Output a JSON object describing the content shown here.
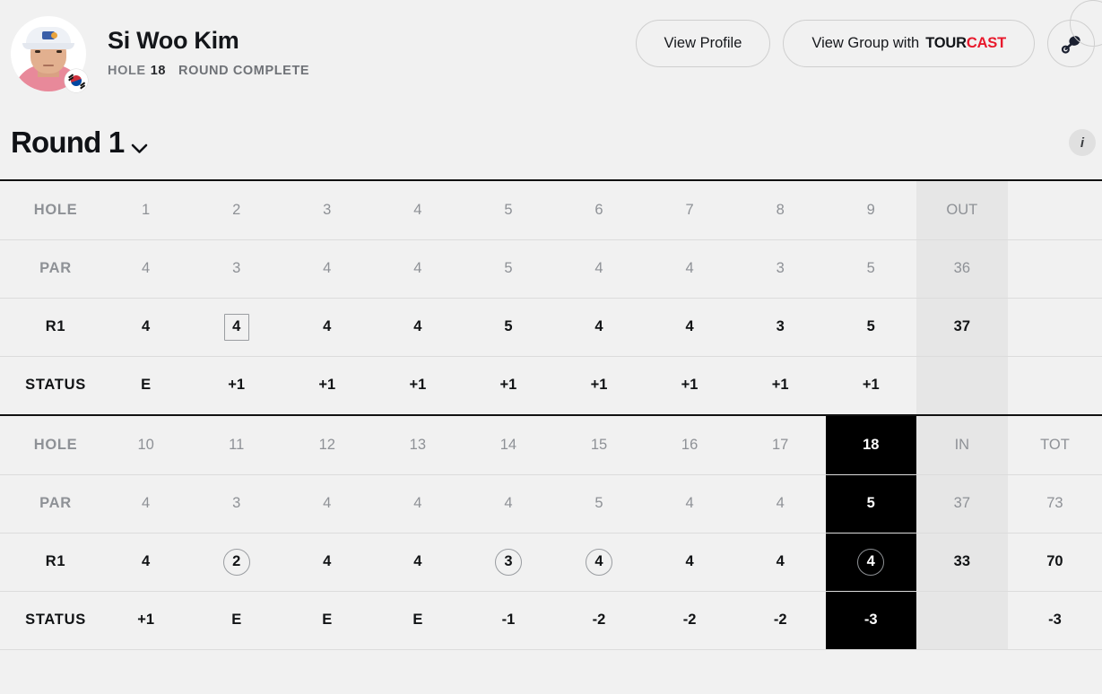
{
  "header": {
    "player_name": "Si Woo Kim",
    "hole_label": "HOLE",
    "hole_number": "18",
    "round_state": "ROUND COMPLETE",
    "view_profile_label": "View Profile",
    "view_group_label": "View Group with",
    "tourcast_tour": "TOUR",
    "tourcast_cast": "CAST",
    "flag_country": "South Korea"
  },
  "round_selector": {
    "label": "Round 1",
    "chevron": "chevron-down-icon",
    "info_label": "i"
  },
  "row_labels": {
    "hole": "HOLE",
    "par": "PAR",
    "score": "R1",
    "status": "STATUS"
  },
  "front_nine": {
    "agg_header": "OUT",
    "holes": [
      "1",
      "2",
      "3",
      "4",
      "5",
      "6",
      "7",
      "8",
      "9"
    ],
    "pars": [
      "4",
      "3",
      "4",
      "4",
      "5",
      "4",
      "4",
      "3",
      "5"
    ],
    "scores": [
      "4",
      "4",
      "4",
      "4",
      "5",
      "4",
      "4",
      "3",
      "5"
    ],
    "score_marks": [
      "",
      "square",
      "",
      "",
      "",
      "",
      "",
      "",
      ""
    ],
    "statuses": [
      "E",
      "+1",
      "+1",
      "+1",
      "+1",
      "+1",
      "+1",
      "+1",
      "+1"
    ],
    "par_total": "36",
    "score_total": "37",
    "status_total": "",
    "highlight_index": -1
  },
  "back_nine": {
    "agg_header": "IN",
    "tot_header": "TOT",
    "holes": [
      "10",
      "11",
      "12",
      "13",
      "14",
      "15",
      "16",
      "17",
      "18"
    ],
    "pars": [
      "4",
      "3",
      "4",
      "4",
      "4",
      "5",
      "4",
      "4",
      "5"
    ],
    "scores": [
      "4",
      "2",
      "4",
      "4",
      "3",
      "4",
      "4",
      "4",
      "4"
    ],
    "score_marks": [
      "",
      "circle",
      "",
      "",
      "circle",
      "circle",
      "",
      "",
      "circle"
    ],
    "statuses": [
      "+1",
      "E",
      "E",
      "E",
      "-1",
      "-2",
      "-2",
      "-2",
      "-3"
    ],
    "par_total": "37",
    "score_total": "33",
    "status_total": "",
    "par_grand": "73",
    "score_grand": "70",
    "status_grand": "-3",
    "highlight_index": 8
  },
  "colors": {
    "page_bg": "#f1f1f1",
    "accent_red": "#e8192c",
    "highlight_bg": "#000000",
    "agg_bg": "#e6e6e6",
    "muted_text": "#8e9196"
  }
}
